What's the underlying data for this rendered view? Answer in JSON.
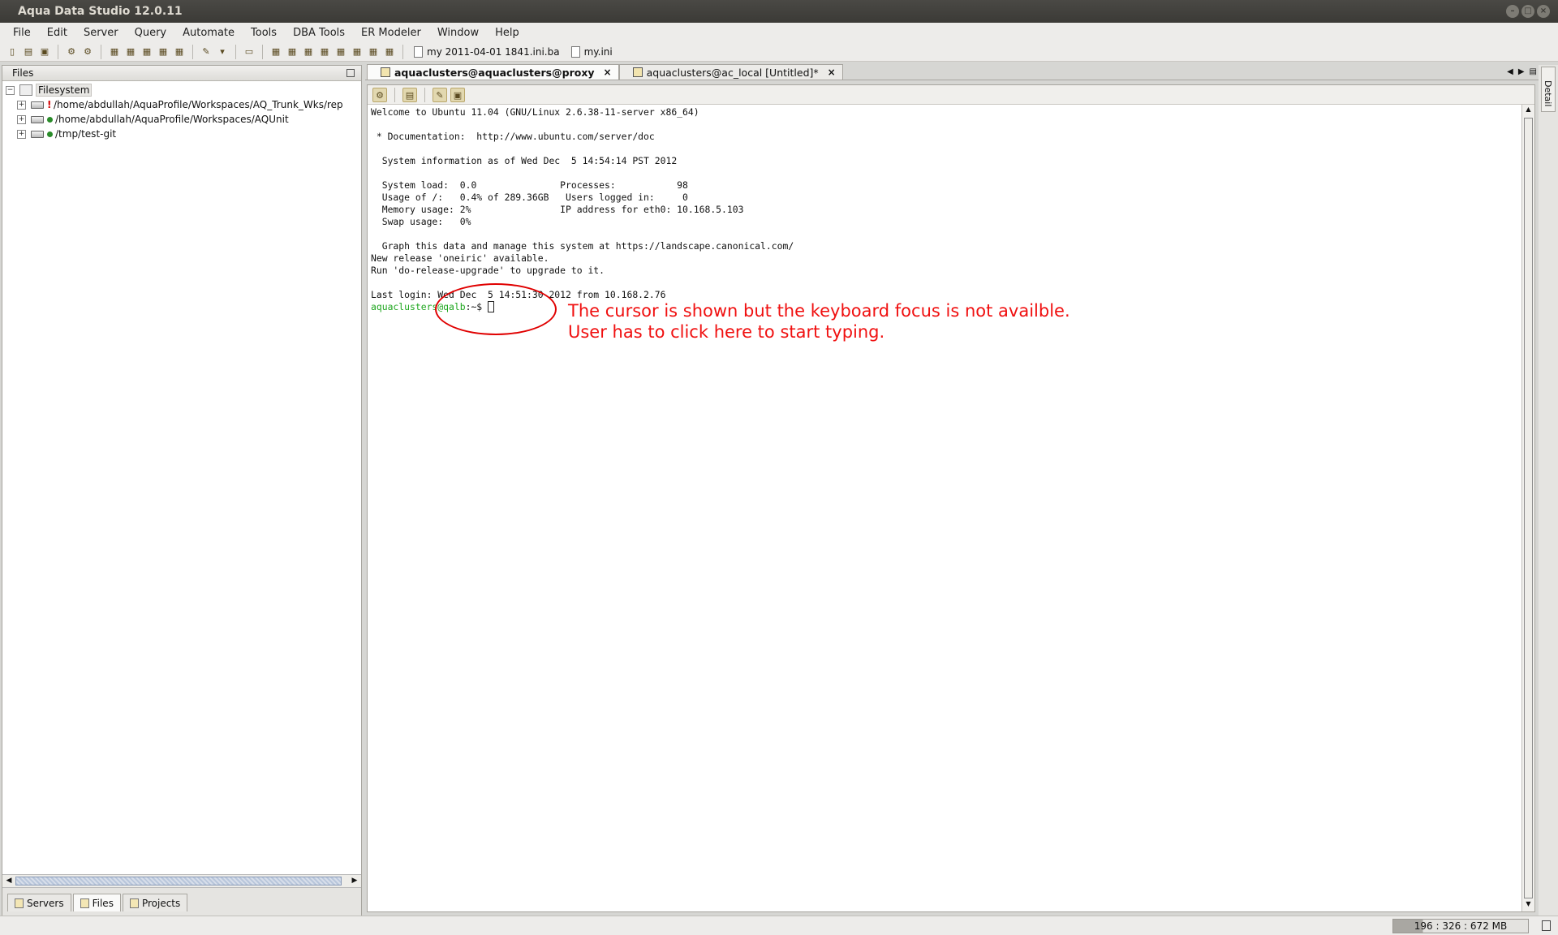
{
  "window": {
    "title": "Aqua Data Studio 12.0.11"
  },
  "menu": [
    "File",
    "Edit",
    "Server",
    "Query",
    "Automate",
    "Tools",
    "DBA Tools",
    "ER Modeler",
    "Window",
    "Help"
  ],
  "toolbar": {
    "files": [
      "my 2011-04-01 1841.ini.ba",
      "my.ini"
    ]
  },
  "left_panel": {
    "title": "Files",
    "root": "Filesystem",
    "items": [
      {
        "path": "/home/abdullah/AquaProfile/Workspaces/AQ_Trunk_Wks/rep",
        "status": "!"
      },
      {
        "path": "/home/abdullah/AquaProfile/Workspaces/AQUnit",
        "status": "ok"
      },
      {
        "path": "/tmp/test-git",
        "status": "ok"
      }
    ],
    "tabs": [
      "Servers",
      "Files",
      "Projects"
    ]
  },
  "editor_tabs": [
    {
      "label": "aquaclusters@aquaclusters@proxy",
      "active": true
    },
    {
      "label": "aquaclusters@ac_local [Untitled]*",
      "active": false
    }
  ],
  "terminal": {
    "lines": [
      "Welcome to Ubuntu 11.04 (GNU/Linux 2.6.38-11-server x86_64)",
      "",
      " * Documentation:  http://www.ubuntu.com/server/doc",
      "",
      "  System information as of Wed Dec  5 14:54:14 PST 2012",
      "",
      "  System load:  0.0               Processes:           98",
      "  Usage of /:   0.4% of 289.36GB   Users logged in:     0",
      "  Memory usage: 2%                IP address for eth0: 10.168.5.103",
      "  Swap usage:   0%",
      "",
      "  Graph this data and manage this system at https://landscape.canonical.com/",
      "New release 'oneiric' available.",
      "Run 'do-release-upgrade' to upgrade to it.",
      "",
      "Last login: Wed Dec  5 14:51:30 2012 from 10.168.2.76"
    ],
    "prompt_user": "aquaclusters@qalb",
    "prompt_tail": ":~$ "
  },
  "annotation": {
    "line1": "The cursor is shown but the keyboard focus is not availble.",
    "line2": "User has to click here to start typing.",
    "color": "#f01010"
  },
  "right_strip": {
    "label": "Detail"
  },
  "status": {
    "memory": "196 : 326 : 672 MB"
  }
}
